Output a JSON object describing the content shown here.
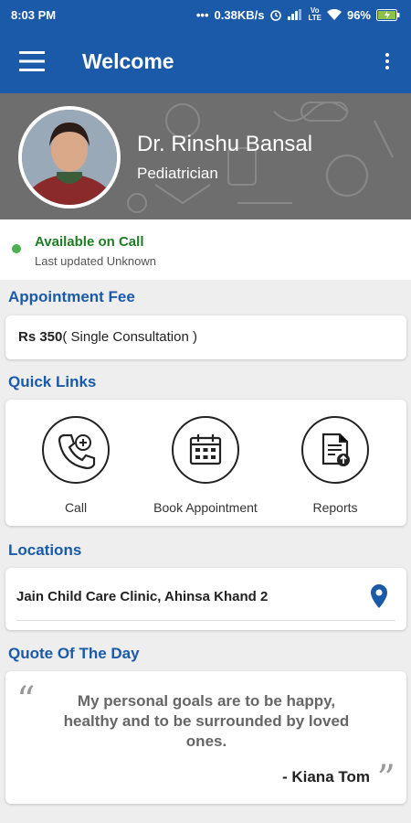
{
  "status_bar": {
    "time": "8:03 PM",
    "net_speed": "0.38KB/s",
    "battery": "96%"
  },
  "app_bar": {
    "title": "Welcome",
    "menu_icon": "hamburger-icon",
    "more_icon": "more-vert-icon"
  },
  "doctor": {
    "name": "Dr. Rinshu Bansal",
    "specialty": "Pediatrician"
  },
  "availability": {
    "status": "Available on Call",
    "updated": "Last updated Unknown"
  },
  "sections": {
    "fee_title": "Appointment Fee",
    "quick_links_title": "Quick Links",
    "locations_title": "Locations",
    "quote_title": "Quote Of The Day"
  },
  "fee": {
    "amount": "Rs 350",
    "detail": "( Single Consultation )"
  },
  "quick_links": [
    {
      "label": "Call",
      "icon": "phone-add-icon"
    },
    {
      "label": "Book Appointment",
      "icon": "calendar-icon"
    },
    {
      "label": "Reports",
      "icon": "report-upload-icon"
    }
  ],
  "location": {
    "name": "Jain Child Care Clinic, Ahinsa Khand 2",
    "icon": "map-pin-icon"
  },
  "quote": {
    "text": "My personal goals are to be happy, healthy and to be surrounded by loved ones.",
    "author": "- Kiana Tom"
  },
  "colors": {
    "primary": "#1a5aa8",
    "available": "#4caf50"
  }
}
